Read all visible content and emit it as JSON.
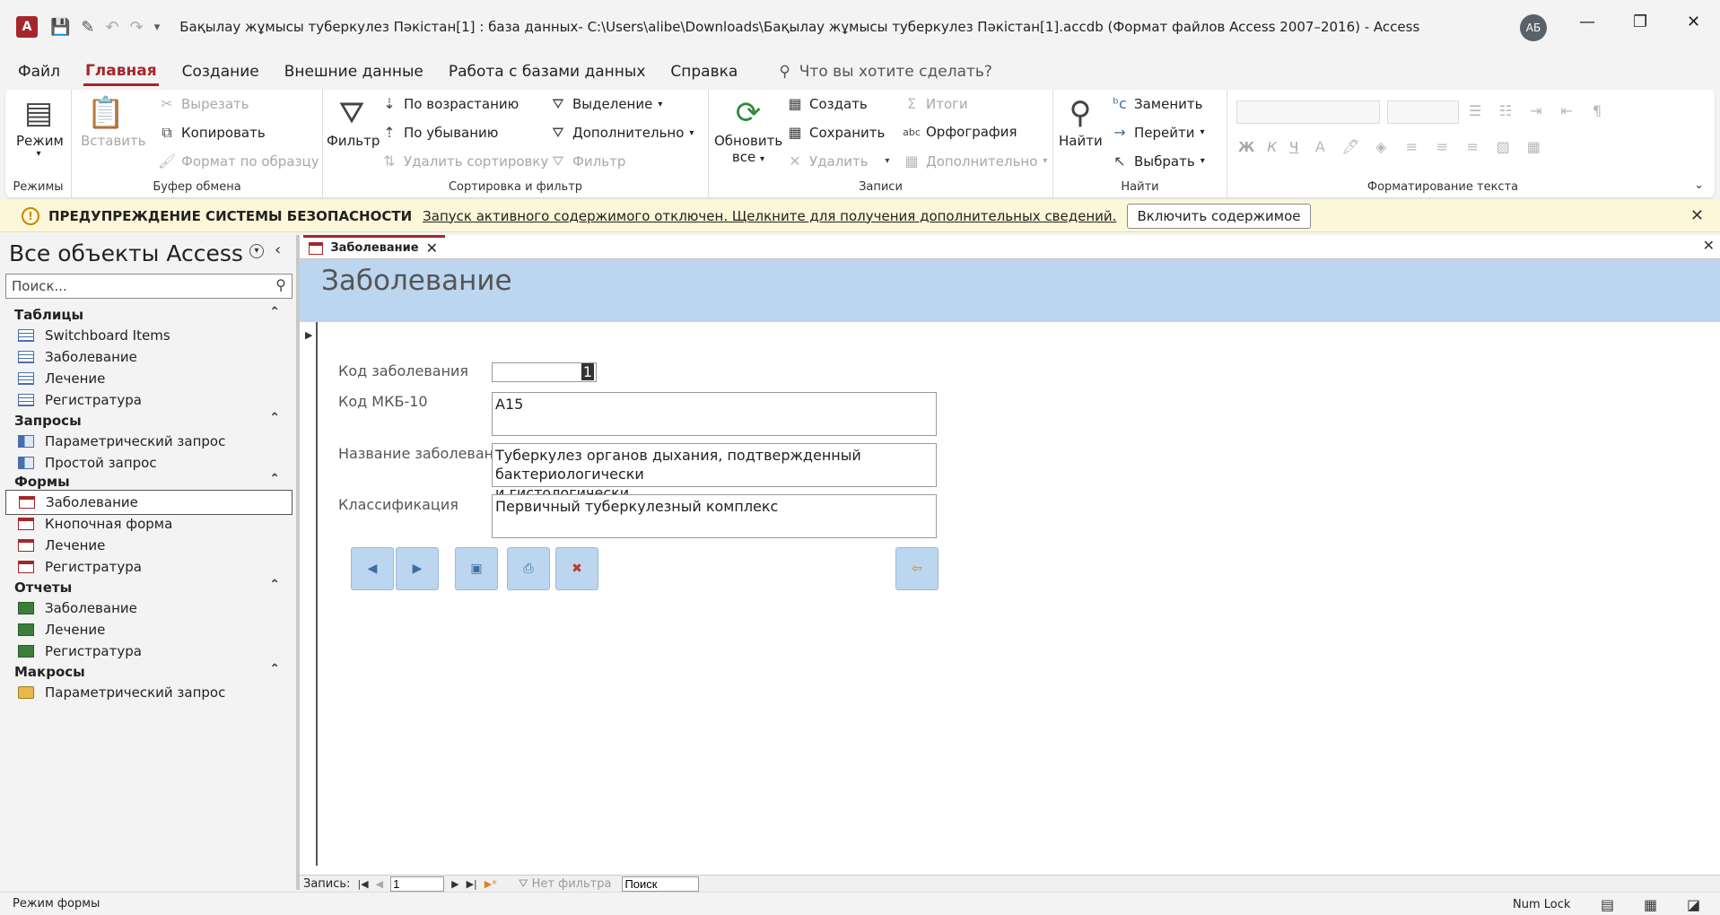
{
  "app": {
    "logo_letter": "A",
    "title": "Бақылау жұмысы туберкулез Пәкістан[1] : база данных- C:\\Users\\alibe\\Downloads\\Бақылау жұмысы туберкулез Пәкістан[1].accdb (Формат файлов Access 2007–2016)  -  Access",
    "user_initials": "АБ"
  },
  "menu": {
    "tabs": [
      "Файл",
      "Главная",
      "Создание",
      "Внешние данные",
      "Работа с базами данных",
      "Справка"
    ],
    "active": "Главная",
    "tellme_placeholder": "Что вы хотите сделать?"
  },
  "ribbon": {
    "modes": {
      "label": "Режимы",
      "view": "Режим"
    },
    "clipboard": {
      "label": "Буфер обмена",
      "paste": "Вставить",
      "cut": "Вырезать",
      "copy": "Копировать",
      "format_painter": "Формат по образцу"
    },
    "sort": {
      "label": "Сортировка и фильтр",
      "filter": "Фильтр",
      "asc": "По возрастанию",
      "desc": "По убыванию",
      "remove_sort": "Удалить сортировку",
      "selection": "Выделение",
      "advanced": "Дополнительно",
      "toggle_filter": "Фильтр"
    },
    "records": {
      "label": "Записи",
      "refresh": "Обновить",
      "refresh2": "все",
      "new": "Создать",
      "save": "Сохранить",
      "delete": "Удалить",
      "totals": "Итоги",
      "spelling": "Орфография",
      "more": "Дополнительно"
    },
    "find": {
      "label": "Найти",
      "find": "Найти",
      "replace": "Заменить",
      "goto": "Перейти",
      "select": "Выбрать"
    },
    "text_format": {
      "label": "Форматирование текста",
      "bold": "Ж",
      "italic": "К",
      "underline": "Ч"
    }
  },
  "security": {
    "title": "ПРЕДУПРЕЖДЕНИЕ СИСТЕМЫ БЕЗОПАСНОСТИ",
    "message": "Запуск активного содержимого отключен. Щелкните для получения дополнительных сведений.",
    "button": "Включить содержимое"
  },
  "nav": {
    "title": "Все объекты Access",
    "search_placeholder": "Поиск...",
    "groups": [
      {
        "name": "Таблицы",
        "kind": "table",
        "items": [
          "Switchboard Items",
          "Заболевание",
          "Лечение",
          "Регистратура"
        ]
      },
      {
        "name": "Запросы",
        "kind": "query",
        "items": [
          "Параметрический запрос",
          "Простой запрос"
        ]
      },
      {
        "name": "Формы",
        "kind": "form",
        "items": [
          "Заболевание",
          "Кнопочная форма",
          "Лечение",
          "Регистратура"
        ],
        "selected": 0
      },
      {
        "name": "Отчеты",
        "kind": "report",
        "items": [
          "Заболевание",
          "Лечение",
          "Регистратура"
        ]
      },
      {
        "name": "Макросы",
        "kind": "macro",
        "items": [
          "Параметрический запрос"
        ]
      }
    ]
  },
  "doc": {
    "tab": "Заболевание",
    "form_title": "Заболевание",
    "fields": {
      "id_label": "Код заболевания",
      "id_value": "1",
      "icd_label": "Код МКБ-10",
      "icd_value": "A15",
      "name_label": "Название заболевания",
      "name_line1": "Туберкулез органов дыхания, подтвержденный бактериологически",
      "name_line2": "и гистологически",
      "class_label": "Классификация",
      "class_value": "Первичный туберкулезный комплекс"
    }
  },
  "record_nav": {
    "label": "Запись:",
    "current": "1",
    "filter": "Нет фильтра",
    "search": "Поиск"
  },
  "status": {
    "mode": "Режим формы",
    "numlock": "Num Lock"
  }
}
